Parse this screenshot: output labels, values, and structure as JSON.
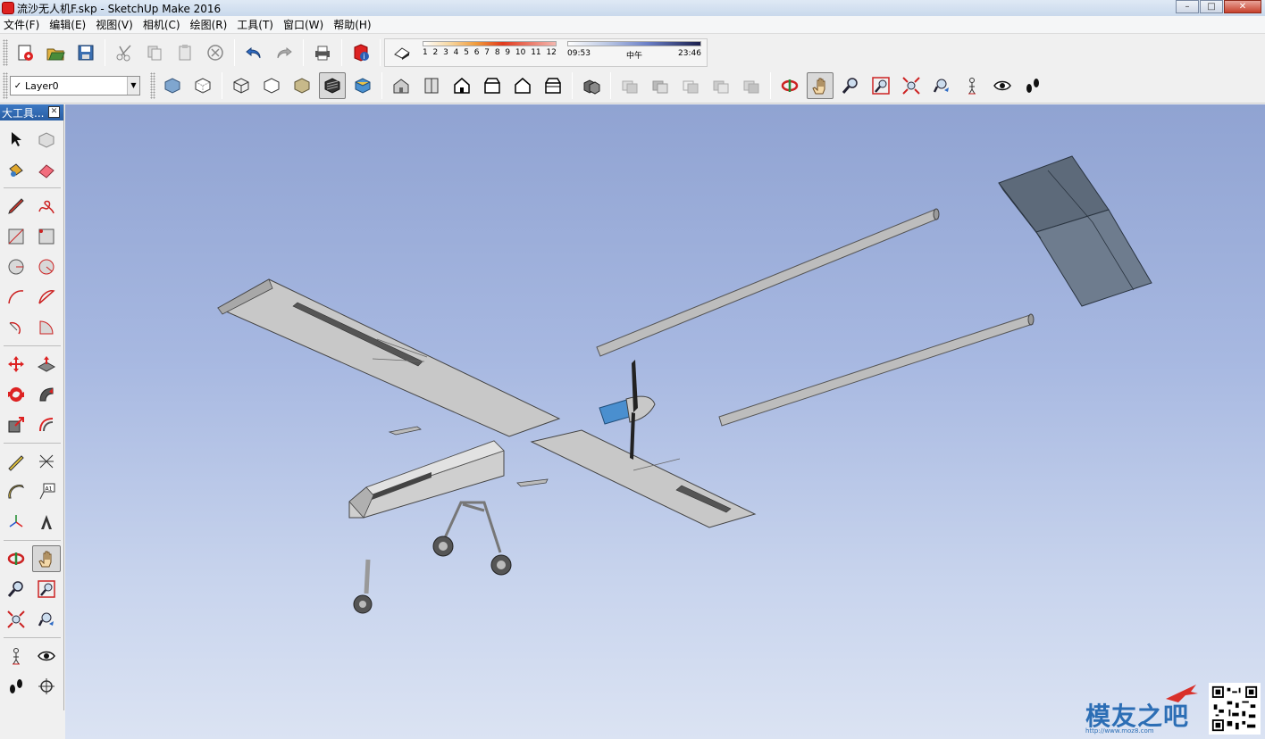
{
  "window": {
    "title": "流沙无人机F.skp - SketchUp Make 2016"
  },
  "menu": [
    "文件(F)",
    "编辑(E)",
    "视图(V)",
    "相机(C)",
    "绘图(R)",
    "工具(T)",
    "窗口(W)",
    "帮助(H)"
  ],
  "shadow": {
    "months": [
      "1",
      "2",
      "3",
      "4",
      "5",
      "6",
      "7",
      "8",
      "9",
      "10",
      "11",
      "12"
    ],
    "time_start": "09:53",
    "time_mid": "中午",
    "time_end": "23:46"
  },
  "layers": {
    "current": "Layer0"
  },
  "palette": {
    "title": "大工具..."
  },
  "watermark": {
    "brand": "模友之吧",
    "url": "http://www.moz8.com"
  },
  "colors": {
    "viewport_top": "#90a3d2",
    "viewport_bottom": "#dbe3f3",
    "part_gray": "#c8c8c8",
    "tail_blue_gray": "#6b7a8c",
    "spinner_blue": "#4a8fcf"
  }
}
